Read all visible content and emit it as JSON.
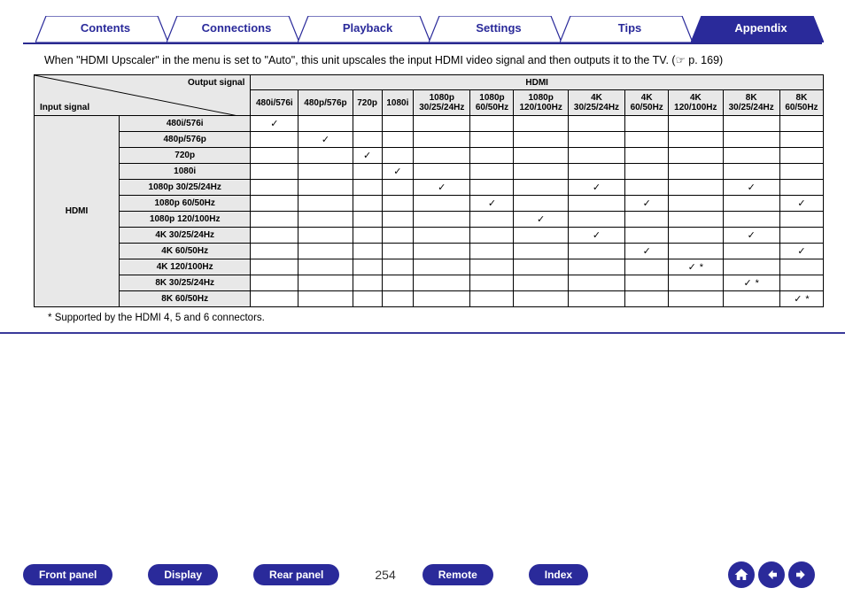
{
  "tabs": {
    "contents": "Contents",
    "connections": "Connections",
    "playback": "Playback",
    "settings": "Settings",
    "tips": "Tips",
    "appendix": "Appendix"
  },
  "intro_pre": "When \"HDMI Upscaler\" in the menu is set to \"Auto\", this unit upscales the input HDMI video signal and then outputs it to the TV. (",
  "intro_page": "p. 169)",
  "table": {
    "diag_out": "Output signal",
    "diag_in": "Input signal",
    "group_header": "HDMI",
    "out_cols": [
      "480i/576i",
      "480p/576p",
      "720p",
      "1080i",
      "1080p 30/25/24Hz",
      "1080p 60/50Hz",
      "1080p 120/100Hz",
      "4K 30/25/24Hz",
      "4K 60/50Hz",
      "4K 120/100Hz",
      "8K 30/25/24Hz",
      "8K 60/50Hz"
    ],
    "row_group": "HDMI",
    "rows": [
      {
        "name": "480i/576i",
        "cells": [
          "✓",
          "",
          "",
          "",
          "",
          "",
          "",
          "",
          "",
          "",
          "",
          ""
        ]
      },
      {
        "name": "480p/576p",
        "cells": [
          "",
          "✓",
          "",
          "",
          "",
          "",
          "",
          "",
          "",
          "",
          "",
          ""
        ]
      },
      {
        "name": "720p",
        "cells": [
          "",
          "",
          "✓",
          "",
          "",
          "",
          "",
          "",
          "",
          "",
          "",
          ""
        ]
      },
      {
        "name": "1080i",
        "cells": [
          "",
          "",
          "",
          "✓",
          "",
          "",
          "",
          "",
          "",
          "",
          "",
          ""
        ]
      },
      {
        "name": "1080p 30/25/24Hz",
        "cells": [
          "",
          "",
          "",
          "",
          "✓",
          "",
          "",
          "✓",
          "",
          "",
          "✓",
          ""
        ]
      },
      {
        "name": "1080p 60/50Hz",
        "cells": [
          "",
          "",
          "",
          "",
          "",
          "✓",
          "",
          "",
          "✓",
          "",
          "",
          "✓"
        ]
      },
      {
        "name": "1080p 120/100Hz",
        "cells": [
          "",
          "",
          "",
          "",
          "",
          "",
          "✓",
          "",
          "",
          "",
          "",
          ""
        ]
      },
      {
        "name": "4K 30/25/24Hz",
        "cells": [
          "",
          "",
          "",
          "",
          "",
          "",
          "",
          "✓",
          "",
          "",
          "✓",
          ""
        ]
      },
      {
        "name": "4K 60/50Hz",
        "cells": [
          "",
          "",
          "",
          "",
          "",
          "",
          "",
          "",
          "✓",
          "",
          "",
          "✓"
        ]
      },
      {
        "name": "4K 120/100Hz",
        "cells": [
          "",
          "",
          "",
          "",
          "",
          "",
          "",
          "",
          "",
          "✓ *",
          "",
          ""
        ]
      },
      {
        "name": "8K 30/25/24Hz",
        "cells": [
          "",
          "",
          "",
          "",
          "",
          "",
          "",
          "",
          "",
          "",
          "✓ *",
          ""
        ]
      },
      {
        "name": "8K 60/50Hz",
        "cells": [
          "",
          "",
          "",
          "",
          "",
          "",
          "",
          "",
          "",
          "",
          "",
          "✓ *"
        ]
      }
    ]
  },
  "footnote_marker": "*",
  "footnote": "Supported by the HDMI 4, 5 and 6 connectors.",
  "bottom": {
    "front_panel": "Front panel",
    "display": "Display",
    "rear_panel": "Rear panel",
    "remote": "Remote",
    "index": "Index",
    "page": "254"
  }
}
